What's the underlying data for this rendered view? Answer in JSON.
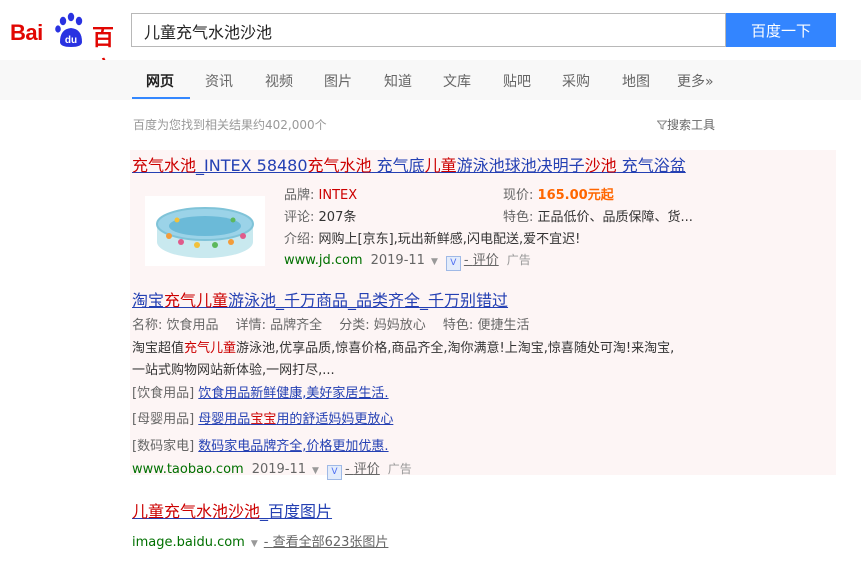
{
  "logo": {
    "bai": "Bai",
    "du": "百度",
    "paw_text": "du"
  },
  "search": {
    "query": "儿童充气水池沙池",
    "button_label": "百度一下"
  },
  "tabs": [
    "网页",
    "资讯",
    "视频",
    "图片",
    "知道",
    "文库",
    "贴吧",
    "采购",
    "地图",
    "更多»"
  ],
  "stats_text": "百度为您找到相关结果约402,000个",
  "tools_label": "搜索工具",
  "result1": {
    "title_parts": [
      "充气水池",
      "_INTEX 58480",
      "充气水池",
      " 充气底",
      "儿童",
      "游泳池球池决明子",
      "沙池",
      " 充气浴盆"
    ],
    "brand_label": "品牌:",
    "brand_value": "INTEX",
    "price_label": "现价:",
    "price_value": "165.00元起",
    "review_label": "评论:",
    "review_value": "207条",
    "feature_label": "特色:",
    "feature_value": "正品低价、品质保障、货...",
    "intro_label": "介绍:",
    "intro_value": "网购上[京东],玩出新鲜感,闪电配送,爱不宜迟!",
    "url": "www.jd.com",
    "date": "2019-11",
    "review_link": "评价",
    "ad_label": "广告"
  },
  "result2": {
    "title_parts": [
      "淘宝",
      "充气儿童",
      "游泳池_千万商品_品类齐全_千万别错过"
    ],
    "meta": "名称: 饮食用品　 详情: 品牌齐全　 分类: 妈妈放心　 特色: 便捷生活",
    "desc1_parts": [
      "淘宝超值",
      "充气儿童",
      "游泳池,优享品质,惊喜价格,商品齐全,淘你满意!上淘宝,惊喜随处可淘!来淘宝,"
    ],
    "desc2": "一站式购物网站新体验,一网打尽,...",
    "sublinks": [
      {
        "cat": "[饮食用品]",
        "parts": [
          "饮食用品新鲜健康,美好家居生活."
        ]
      },
      {
        "cat": "[母婴用品]",
        "parts": [
          "母婴用品",
          "宝宝",
          "用的舒适妈妈更放心"
        ]
      },
      {
        "cat": "[数码家电]",
        "parts": [
          "数码家电品牌齐全,价格更加优惠."
        ]
      }
    ],
    "url": "www.taobao.com",
    "date": "2019-11",
    "review_link": "评价",
    "ad_label": "广告"
  },
  "result3": {
    "title_parts": [
      "儿童充气水池沙池",
      "_百度图片"
    ],
    "url": "image.baidu.com",
    "link_text": "查看全部623张图片"
  },
  "colors": {
    "accent": "#3385ff",
    "brand_red": "#e10602",
    "link": "#2440b3",
    "highlight": "#c00",
    "url_green": "#007000"
  }
}
